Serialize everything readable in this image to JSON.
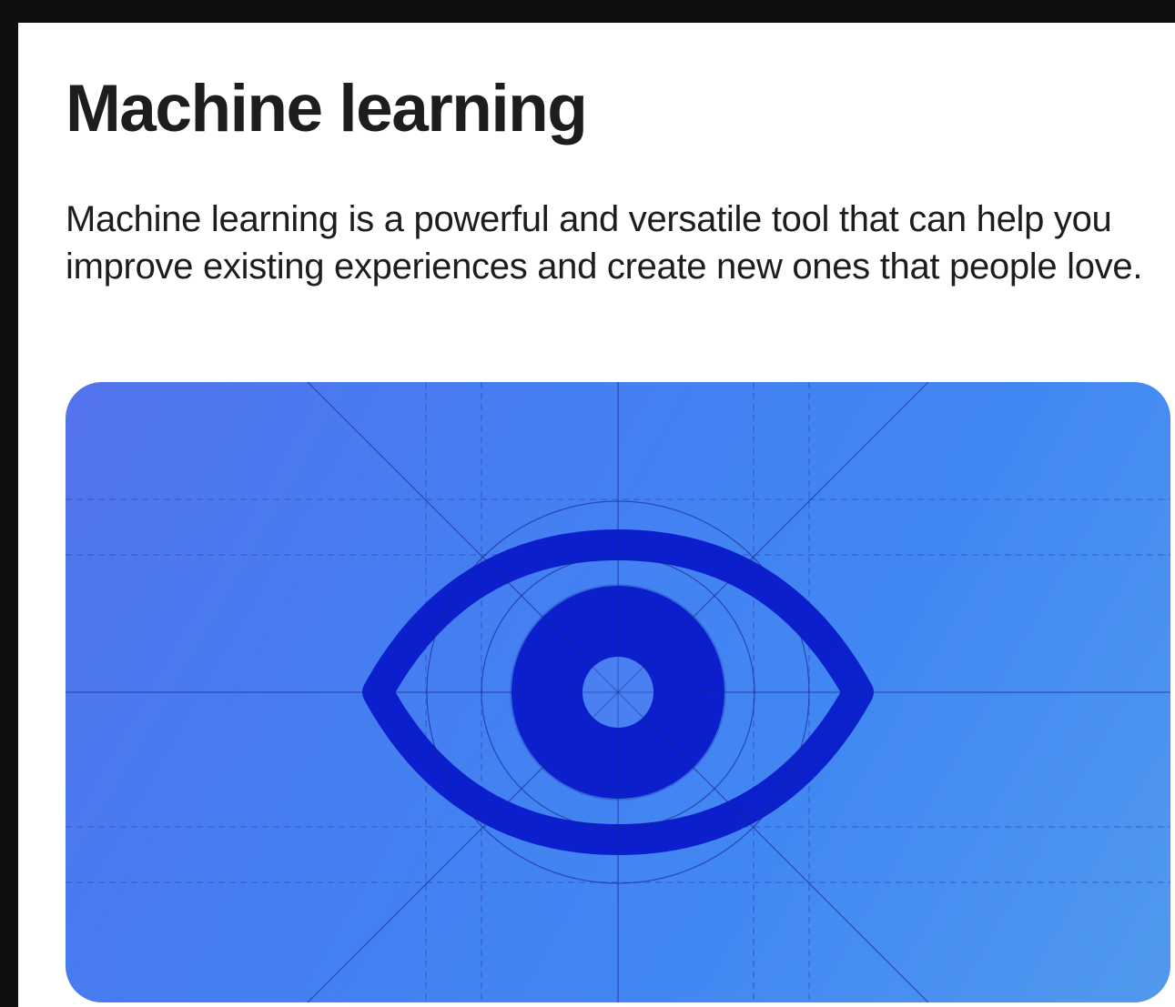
{
  "article": {
    "title": "Machine learning",
    "intro": "Machine learning is a powerful and versatile tool that can help you improve existing experiences and create new ones that people love."
  },
  "hero_image": {
    "icon": "eye-icon",
    "background_start": "#5473ec",
    "background_end": "#5099ee",
    "icon_color": "#0618c9",
    "grid_color": "#2c45b8"
  }
}
